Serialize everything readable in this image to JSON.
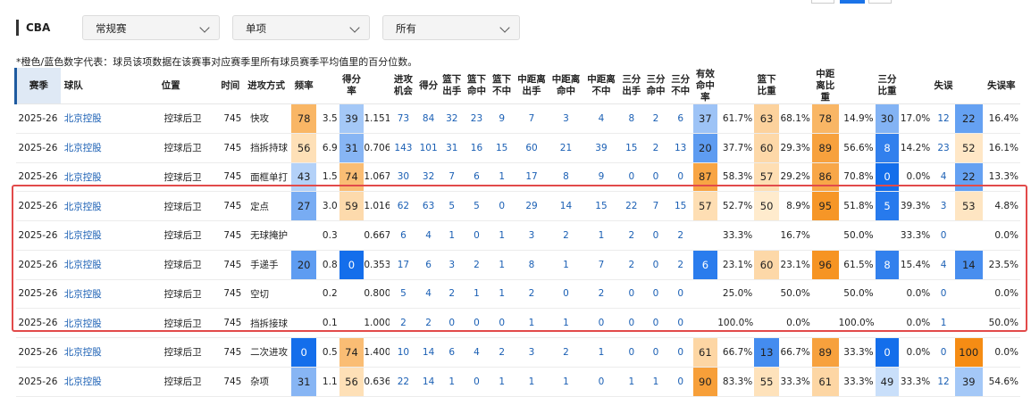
{
  "filters": {
    "league": "CBA",
    "season_type": "常规赛",
    "mode": "单项",
    "scope": "所有"
  },
  "note": "*橙色/蓝色数字代表：球员该项数据在该赛事对应赛季里所有球员赛季平均值里的百分位数。",
  "headers": [
    "赛季",
    "球队",
    "位置",
    "时间",
    "进攻方式",
    "频率",
    "",
    "得分率",
    "",
    "进攻\n机会",
    "得分",
    "篮下\n出手",
    "篮下\n命中",
    "篮下\n不中",
    "中距离\n出手",
    "中距离\n命中",
    "中距离\n不中",
    "三分\n出手",
    "三分\n命中",
    "三分\n不中",
    "有效\n命中率",
    "",
    "篮下比重",
    "",
    "中距离比重",
    "",
    "三分比重",
    "",
    "失误",
    "",
    "失误率"
  ],
  "rows": [
    [
      "2025-26",
      "北京控股",
      "控球后卫",
      "745",
      "快攻",
      "78",
      "3.5",
      "39",
      "1.151",
      "73",
      "84",
      "32",
      "23",
      "9",
      "7",
      "3",
      "4",
      "8",
      "2",
      "6",
      "37",
      "61.7%",
      "63",
      "68.1%",
      "78",
      "14.9%",
      "30",
      "17.0%",
      "12",
      "22",
      "16.4%"
    ],
    [
      "2025-26",
      "北京控股",
      "控球后卫",
      "745",
      "挡拆持球",
      "56",
      "6.9",
      "31",
      "0.706",
      "143",
      "101",
      "31",
      "16",
      "15",
      "60",
      "21",
      "39",
      "15",
      "2",
      "13",
      "20",
      "37.7%",
      "60",
      "29.3%",
      "89",
      "56.6%",
      "8",
      "14.2%",
      "23",
      "52",
      "16.1%"
    ],
    [
      "2025-26",
      "北京控股",
      "控球后卫",
      "745",
      "面框单打",
      "43",
      "1.5",
      "74",
      "1.067",
      "30",
      "32",
      "7",
      "6",
      "1",
      "17",
      "8",
      "9",
      "0",
      "0",
      "0",
      "87",
      "58.3%",
      "57",
      "29.2%",
      "86",
      "70.8%",
      "0",
      "0.0%",
      "4",
      "22",
      "13.3%"
    ],
    [
      "2025-26",
      "北京控股",
      "控球后卫",
      "745",
      "定点",
      "27",
      "3.0",
      "59",
      "1.016",
      "62",
      "63",
      "5",
      "5",
      "0",
      "29",
      "14",
      "15",
      "22",
      "7",
      "15",
      "57",
      "52.7%",
      "50",
      "8.9%",
      "95",
      "51.8%",
      "5",
      "39.3%",
      "3",
      "53",
      "4.8%"
    ],
    [
      "2025-26",
      "北京控股",
      "控球后卫",
      "745",
      "无球掩护",
      "",
      "0.3",
      "",
      "0.667",
      "6",
      "4",
      "1",
      "0",
      "1",
      "3",
      "2",
      "1",
      "2",
      "0",
      "2",
      "",
      "33.3%",
      "",
      "16.7%",
      "",
      "50.0%",
      "",
      "33.3%",
      "0",
      "",
      "0.0%"
    ],
    [
      "2025-26",
      "北京控股",
      "控球后卫",
      "745",
      "手递手",
      "20",
      "0.8",
      "0",
      "0.353",
      "17",
      "6",
      "3",
      "2",
      "1",
      "8",
      "1",
      "7",
      "2",
      "0",
      "2",
      "6",
      "23.1%",
      "60",
      "23.1%",
      "96",
      "61.5%",
      "8",
      "15.4%",
      "4",
      "14",
      "23.5%"
    ],
    [
      "2025-26",
      "北京控股",
      "控球后卫",
      "745",
      "空切",
      "",
      "0.2",
      "",
      "0.800",
      "5",
      "4",
      "2",
      "1",
      "1",
      "2",
      "0",
      "2",
      "0",
      "0",
      "0",
      "",
      "25.0%",
      "",
      "50.0%",
      "",
      "50.0%",
      "",
      "0.0%",
      "0",
      "",
      "0.0%"
    ],
    [
      "2025-26",
      "北京控股",
      "控球后卫",
      "745",
      "挡拆接球",
      "",
      "0.1",
      "",
      "1.000",
      "2",
      "2",
      "0",
      "0",
      "0",
      "1",
      "1",
      "0",
      "0",
      "0",
      "0",
      "",
      "100.0%",
      "",
      "0.0%",
      "",
      "100.0%",
      "",
      "0.0%",
      "1",
      "",
      "50.0%"
    ],
    [
      "2025-26",
      "北京控股",
      "控球后卫",
      "745",
      "二次进攻",
      "0",
      "0.5",
      "74",
      "1.400",
      "10",
      "14",
      "6",
      "4",
      "2",
      "3",
      "2",
      "1",
      "0",
      "0",
      "0",
      "61",
      "66.7%",
      "13",
      "66.7%",
      "89",
      "33.3%",
      "0",
      "0.0%",
      "0",
      "100",
      "0.0%"
    ],
    [
      "2025-26",
      "北京控股",
      "控球后卫",
      "745",
      "杂项",
      "31",
      "1.1",
      "56",
      "0.636",
      "22",
      "14",
      "1",
      "0",
      "1",
      "1",
      "1",
      "0",
      "1",
      "1",
      "0",
      "90",
      "83.3%",
      "55",
      "33.3%",
      "61",
      "33.3%",
      "49",
      "33.3%",
      "12",
      "39",
      "54.6%"
    ]
  ],
  "colors": {
    "orange": "#f5a042",
    "blue": "#1a73e8",
    "link": "#1a5fb4",
    "highlight": "#e24a4a"
  }
}
